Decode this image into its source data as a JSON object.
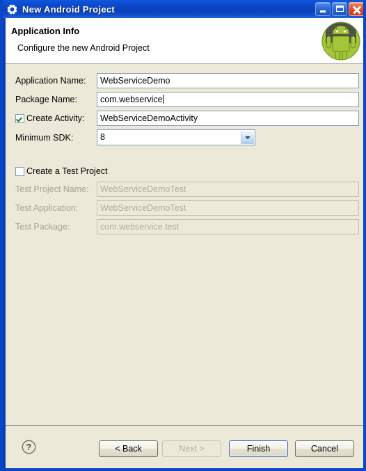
{
  "window": {
    "title": "New Android Project",
    "icon": "gear-icon",
    "minimize_label": "Minimize",
    "maximize_label": "Maximize",
    "close_label": "Close"
  },
  "header": {
    "title": "Application Info",
    "subtitle": "Configure the new Android Project",
    "logo": "android-robot-icon"
  },
  "form": {
    "application_name": {
      "label": "Application Name:",
      "value": "WebServiceDemo"
    },
    "package_name": {
      "label": "Package Name:",
      "value": "com.webservice"
    },
    "create_activity": {
      "label": "Create Activity:",
      "checked": true,
      "value": "WebServiceDemoActivity"
    },
    "minimum_sdk": {
      "label": "Minimum SDK:",
      "value": "8",
      "options": [
        "8"
      ]
    }
  },
  "test_project": {
    "checkbox_label": "Create a Test Project",
    "checked": false,
    "test_project_name": {
      "label": "Test Project Name:",
      "value": "WebServiceDemoTest"
    },
    "test_application": {
      "label": "Test Application:",
      "value": "WebServiceDemoTest"
    },
    "test_package": {
      "label": "Test Package:",
      "value": "com.webservice.test"
    }
  },
  "footer": {
    "help": "?",
    "back": "< Back",
    "next": "Next >",
    "finish": "Finish",
    "cancel": "Cancel"
  },
  "colors": {
    "titlebar_blue": "#0b46c4",
    "dialog_beige": "#ece9d8",
    "field_border": "#7f9db9",
    "android_green": "#a4c639",
    "close_red": "#e2512b",
    "focus_blue": "#2f5fbf"
  }
}
